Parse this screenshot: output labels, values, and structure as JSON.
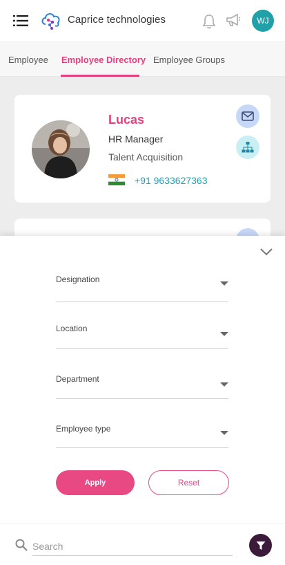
{
  "app": {
    "title": "Caprice technologies",
    "user_initials": "WJ"
  },
  "tabs": [
    {
      "label": "Employee"
    },
    {
      "label": "Employee Directory"
    },
    {
      "label": "Employee Groups"
    }
  ],
  "employee": {
    "name": "Lucas",
    "role": "HR Manager",
    "department": "Talent Acquisition",
    "phone": "+91 9633627363",
    "country_flag": "india-flag-icon"
  },
  "filters": {
    "fields": [
      {
        "label": "Designation"
      },
      {
        "label": "Location"
      },
      {
        "label": "Department"
      },
      {
        "label": "Employee type"
      }
    ],
    "apply_label": "Apply",
    "reset_label": "Reset"
  },
  "search": {
    "placeholder": "Search"
  },
  "colors": {
    "accent": "#e3407e",
    "phone": "#1fa3b5",
    "avatar": "#22a0a8",
    "filter_button": "#3b1a3a"
  }
}
